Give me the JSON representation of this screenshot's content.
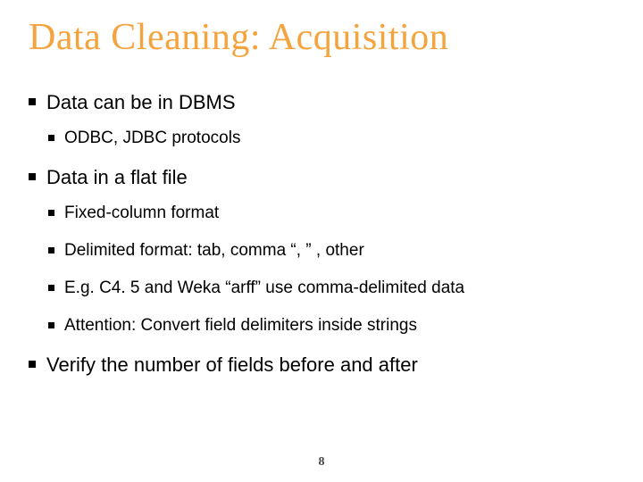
{
  "slide": {
    "title": "Data Cleaning: Acquisition",
    "page_number": "8",
    "bullets": [
      {
        "text": "Data can be in DBMS",
        "sub": [
          {
            "text": "ODBC, JDBC protocols"
          }
        ]
      },
      {
        "text": "Data in a flat file",
        "sub": [
          {
            "text": "Fixed-column format"
          },
          {
            "text": "Delimited format: tab, comma “, ” , other"
          },
          {
            "text": "E.g. C4. 5 and Weka “arff” use comma-delimited data"
          },
          {
            "text": "Attention: Convert field delimiters inside strings"
          }
        ]
      },
      {
        "text": "Verify the number of fields before and after",
        "sub": []
      }
    ]
  }
}
